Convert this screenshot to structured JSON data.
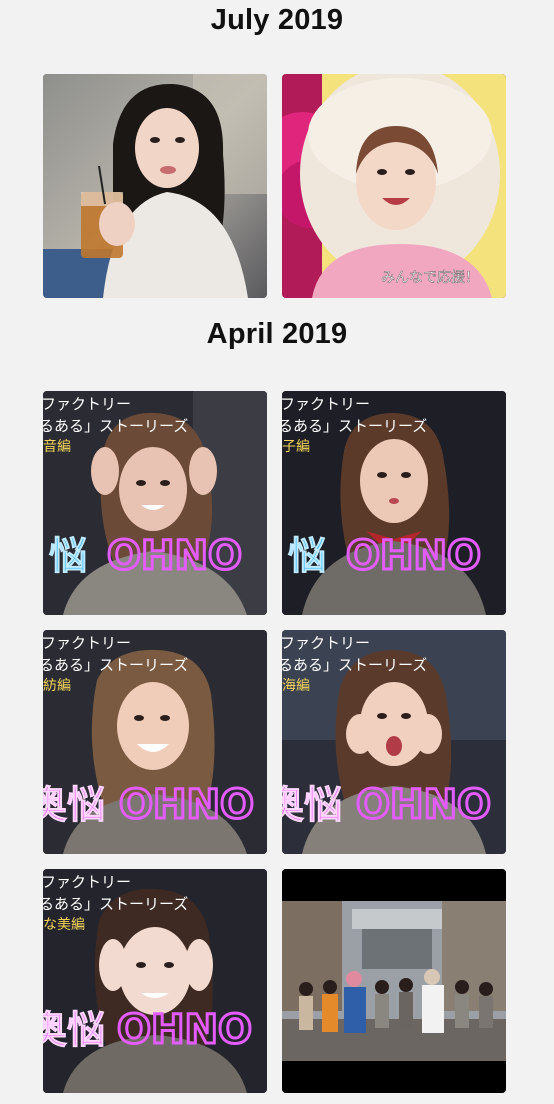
{
  "sections": [
    {
      "title": "July 2019"
    },
    {
      "title": "April 2019"
    }
  ],
  "july": {
    "thumb2_caption": "みんなで応援！"
  },
  "april": {
    "thumbs": [
      {
        "line1": "ファクトリー",
        "line2": "るある」ストーリーズ",
        "line3": "音編",
        "neon_jp": "悩",
        "neon_en": "OHNO"
      },
      {
        "line1": "ファクトリー",
        "line2": "るある」ストーリーズ",
        "line3": "子編",
        "neon_jp": "悩",
        "neon_en": "OHNO"
      },
      {
        "line1": "ファクトリー",
        "line2": "るある」ストーリーズ",
        "line3": "紡編",
        "neon_jp": "奥悩",
        "neon_en": "OHNO"
      },
      {
        "line1": "ファクトリー",
        "line2": "るある」ストーリーズ",
        "line3": "海編",
        "neon_jp": "奥悩",
        "neon_en": "OHNO"
      },
      {
        "line1": "ファクトリー",
        "line2": "るある」ストーリーズ",
        "line3": "な美編",
        "neon_jp": "奥悩",
        "neon_en": "OHNO"
      }
    ]
  },
  "colors": {
    "background": "#f2f2f2",
    "neon_blue": "#57c8ff",
    "neon_pink": "#e45cff",
    "caption_yellow": "#f3d35a"
  }
}
